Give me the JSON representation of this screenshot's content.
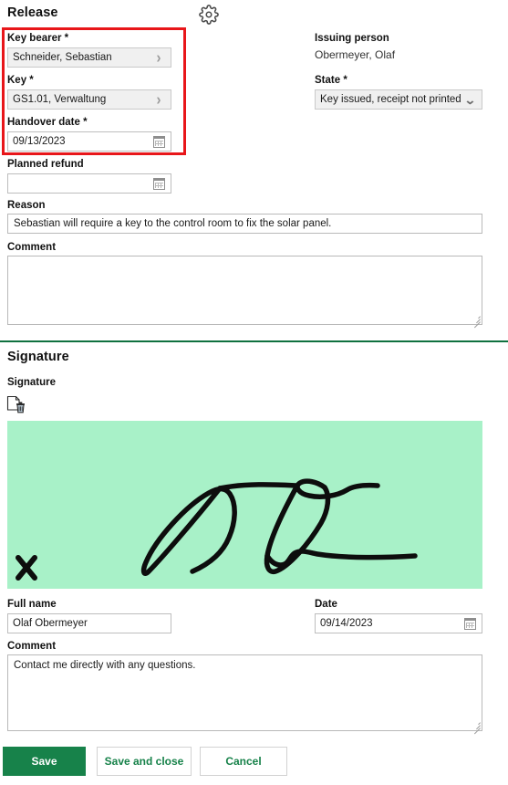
{
  "release": {
    "title": "Release",
    "settings_icon": "gear-icon",
    "key_bearer": {
      "label": "Key bearer *",
      "value": "Schneider, Sebastian",
      "icon": "chevron-right-icon"
    },
    "key": {
      "label": "Key *",
      "value": "GS1.01, Verwaltung",
      "icon": "chevron-right-icon"
    },
    "handover_date": {
      "label": "Handover date *",
      "value": "09/13/2023",
      "icon": "calendar-icon"
    },
    "planned_refund": {
      "label": "Planned refund",
      "value": "",
      "icon": "calendar-icon"
    },
    "issuing_person": {
      "label": "Issuing person",
      "value": "Obermeyer, Olaf"
    },
    "state": {
      "label": "State *",
      "value": "Key issued, receipt not printed",
      "icon": "chevron-down-icon",
      "options": [
        "Key issued, receipt not printed"
      ]
    },
    "reason": {
      "label": "Reason",
      "value": "Sebastian will require a key to the control room to fix the solar panel."
    },
    "comment": {
      "label": "Comment",
      "value": "",
      "placeholder": ""
    }
  },
  "signature": {
    "title": "Signature",
    "label": "Signature",
    "clear_icon": "clear-signature-icon",
    "pad_color": "#a8f1c8",
    "ink_color": "#0d0d0d",
    "x_marker": "X",
    "full_name": {
      "label": "Full name",
      "value": "Olaf Obermeyer"
    },
    "date": {
      "label": "Date",
      "value": "09/14/2023",
      "icon": "calendar-icon"
    },
    "comment": {
      "label": "Comment",
      "value": "Contact me directly with any questions."
    }
  },
  "actions": {
    "save": "Save",
    "save_and_close": "Save and close",
    "cancel": "Cancel"
  },
  "theme": {
    "accent": "#17824a",
    "divider": "#10713f",
    "highlight": "#e8161a"
  }
}
